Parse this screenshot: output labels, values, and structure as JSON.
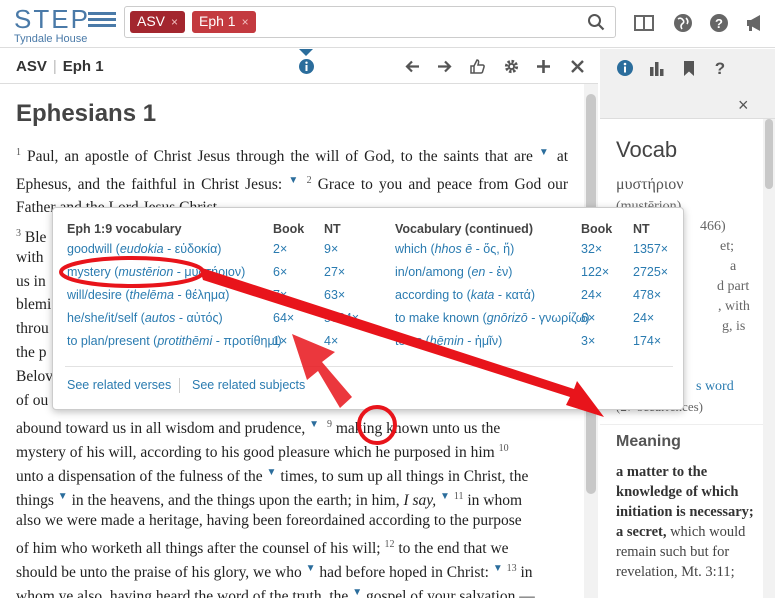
{
  "app": {
    "logo_text": "STEP",
    "logo_sub": "Tyndale House"
  },
  "search": {
    "chips": [
      {
        "label": "ASV",
        "remove": "×"
      },
      {
        "label": "Eph 1",
        "remove": "×"
      }
    ]
  },
  "left_header": {
    "version": "ASV",
    "passage": "Eph 1"
  },
  "passage": {
    "title": "Ephesians 1",
    "verse_1": "Paul, an apostle of Christ Jesus through the will of God, to the saints that are",
    "verse_1b": "at Ephesus, and the faithful in Christ Jesus:",
    "verse_2": "Grace to you and peace from God our Father and the Lord Jesus Christ.",
    "line_3_start": "Ble",
    "fragments": [
      "with",
      "us in",
      "blemi",
      "throu",
      "the p",
      "Belov",
      "of ou"
    ],
    "line_abound": "abound toward us in all wisdom and prudence,",
    "v9_num": "9",
    "line_abound_end": "making known unto us the",
    "line_mystery": "mystery of his will, according to his good pleasure which he purposed in him",
    "v10_num": "10",
    "line_unto": "unto a dispensation of the fulness of the",
    "line_unto_end": "times, to sum up all things in Christ, the",
    "line_things": "things",
    "line_things_mid": "in the heavens, and the things upon the earth; in him,",
    "line_things_isay": "I say,",
    "v11_num": "11",
    "line_things_end": "in whom",
    "line_also": "also we were made a heritage, having been foreordained according to the purpose",
    "line_ofhim": "of him who worketh all things after the counsel of his will;",
    "v12_num": "12",
    "line_ofhim_end": "to the end that we",
    "line_should": "should be unto the praise of his glory, we who",
    "line_should_mid": "had before hoped in Christ:",
    "v13_num": "13",
    "line_should_end": "in",
    "line_whom": "whom ye also, having heard the word of the truth, the",
    "line_whom_end": "gospel of your salvation,—",
    "verse_nums": {
      "v1": "1",
      "v2": "2",
      "v3": "3"
    }
  },
  "popup": {
    "headers": {
      "col1": "Eph 1:9 vocabulary",
      "book": "Book",
      "nt": "NT",
      "col2": "Vocabulary (continued)",
      "book2": "Book",
      "nt2": "NT"
    },
    "left_rows": [
      {
        "en": "goodwill",
        "translit": "eudokia",
        "greek": "εὐδοκία",
        "book": "2×",
        "nt": "9×"
      },
      {
        "en": "mystery",
        "translit": "mustērion",
        "greek": "μυστήριον",
        "book": "6×",
        "nt": "27×"
      },
      {
        "en": "will/desire",
        "translit": "thelēma",
        "greek": "θέλημα",
        "book": "7×",
        "nt": "63×"
      },
      {
        "en": "he/she/it/self",
        "translit": "autos",
        "greek": "αὐτός",
        "book": "64×",
        "nt": "5624×"
      },
      {
        "en": "to plan/present",
        "translit": "protithēmi",
        "greek": "προτίθημι",
        "book": "1×",
        "nt": "4×"
      }
    ],
    "right_rows": [
      {
        "en": "which",
        "translit": "hhos ē",
        "greek": "ὅς, ἥ",
        "book": "32×",
        "nt": "1357×"
      },
      {
        "en": "in/on/among",
        "translit": "en",
        "greek": "ἐν",
        "book": "122×",
        "nt": "2725×"
      },
      {
        "en": "according to",
        "translit": "kata",
        "greek": "κατά",
        "book": "24×",
        "nt": "478×"
      },
      {
        "en": "to make known",
        "translit": "gnōrizō",
        "greek": "γνωρίζω",
        "book": "6×",
        "nt": "24×"
      },
      {
        "en": "to us",
        "translit": "hēmin",
        "greek": "ἡμῖν",
        "book": "3×",
        "nt": "174×"
      }
    ],
    "see_verses": "See related verses",
    "see_subjects": "See related subjects"
  },
  "right_panel": {
    "close": "×",
    "vocab_title": "Vocab",
    "vocab_word": "μυστήριον",
    "partial_lines": [
      {
        "text": "(mustērion)"
      },
      {
        "text": "466)"
      },
      {
        "text": "et;"
      },
      {
        "text": "a"
      },
      {
        "text": "d part"
      },
      {
        "text": ", with"
      },
      {
        "text": "g, is"
      },
      {
        "text": "s word"
      },
      {
        "text": "(27 occurrences)"
      }
    ],
    "meaning_title": "Meaning",
    "meaning_bold_1": "a matter to the knowledge of which initiation is necessary; a",
    "meaning_bold_2": "secret,",
    "meaning_rest": "which would remain such but for revelation, Mt. 3:11;"
  },
  "colors": {
    "brand_blue": "#4a7aa8",
    "chip_red": "#a3262e",
    "link_blue": "#2a7bb0",
    "annotation_red": "#e8141b"
  }
}
